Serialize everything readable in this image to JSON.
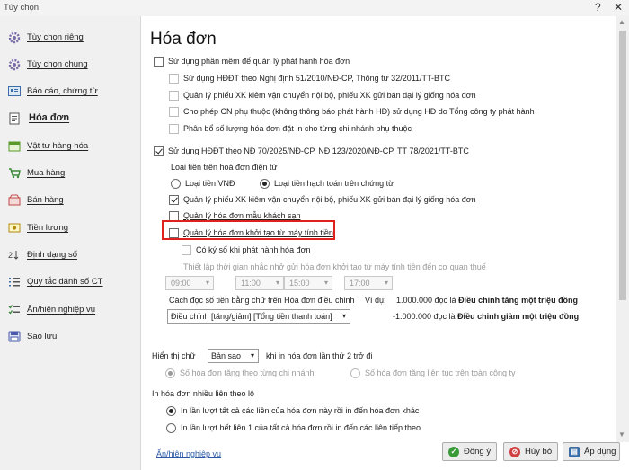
{
  "window": {
    "title": "Tùy chọn",
    "help": "?",
    "close": "✕"
  },
  "sidebar": {
    "items": [
      {
        "label": "Tùy chọn riêng",
        "icon": "gear-icon"
      },
      {
        "label": "Tùy chọn chung",
        "icon": "gear-icon"
      },
      {
        "label": "Báo cáo, chứng từ",
        "icon": "report-icon"
      },
      {
        "label": "Hóa đơn",
        "icon": "invoice-icon",
        "active": true
      },
      {
        "label": "Vật tư hàng hóa",
        "icon": "inventory-icon"
      },
      {
        "label": "Mua hàng",
        "icon": "cart-icon"
      },
      {
        "label": "Bán hàng",
        "icon": "sales-icon"
      },
      {
        "label": "Tiền lương",
        "icon": "salary-icon"
      },
      {
        "label": "Định dạng số",
        "icon": "number-format-icon"
      },
      {
        "label": "Quy tắc đánh số CT",
        "icon": "numbering-icon"
      },
      {
        "label": "Ẩn/hiện nghiệp vụ",
        "icon": "toggle-list-icon"
      },
      {
        "label": "Sao lưu",
        "icon": "backup-icon"
      }
    ]
  },
  "main": {
    "title": "Hóa đơn",
    "opt_software": "Sử dụng phần mềm để quản lý phát hành hóa đơn",
    "opt_nd51": "Sử dụng HĐĐT theo Nghị định 51/2010/NĐ-CP, Thông tư 32/2011/TT-BTC",
    "opt_nd51_xk": "Quản lý phiếu XK kiêm vận chuyển nội bộ, phiếu XK gửi bán đại lý giống hóa đơn",
    "opt_branch": "Cho phép CN phụ thuộc (không thông báo phát hành HĐ) sử dụng HĐ do Tổng công ty phát hành",
    "opt_alloc": "Phân bổ số lượng hóa đơn đặt in cho từng chi nhánh phụ thuộc",
    "opt_nd70": "Sử dụng HĐĐT theo NĐ 70/2025/NĐ-CP, NĐ 123/2020/NĐ-CP, TT 78/2021/TT-BTC",
    "currency_label": "Loại tiền trên hoá đơn điện tử",
    "currency_vnd": "Loại tiền VNĐ",
    "currency_acc": "Loại tiền hạch toán trên chứng từ",
    "opt_xk": "Quản lý phiếu XK kiêm vận chuyển nội bộ, phiếu XK gửi bán đại lý giống hóa đơn",
    "opt_hotel": "Quản lý hóa đơn mẫu khách sạn",
    "opt_cashreg": "Quản lý hóa đơn khởi tạo từ máy tính tiền",
    "opt_signed": "Có ký số khi phát hành hóa đơn",
    "reminder_label": "Thiết lập thời gian nhắc nhở gửi hóa đơn khởi tạo từ máy tính tiền đến cơ quan thuế",
    "times": [
      "09:00",
      "11:00",
      "15:00",
      "17:00"
    ],
    "read_label": "Cách đọc số tiền bằng chữ trên Hóa đơn điều chỉnh",
    "read_value": "Điều chỉnh [tăng/giảm] [Tổng tiền thanh toán]",
    "example_label": "Ví dụ:",
    "example1_prefix": "1.000.000 đọc là ",
    "example1_bold": "Điều chỉnh tăng một triệu đồng",
    "example2_prefix": "-1.000.000 đọc là ",
    "example2_bold": "Điều chỉnh giảm một triệu đồng",
    "show_label": "Hiển thị chữ",
    "show_value": "Bản sao",
    "show_suffix": "khi in hóa đơn lần thứ 2 trở đi",
    "show_opt1": "Số hóa đơn tăng theo từng chi nhánh",
    "show_opt2": "Số hóa đơn tăng liên tục trên toàn công ty",
    "print_label": "In hóa đơn nhiều liên theo lô",
    "print_opt1": "In lần lượt tất cả các liên của hóa đơn này rồi in đến hóa đơn khác",
    "print_opt2": "In lần lượt hết liên 1 của tất cả hóa đơn rồi in đến các liên tiếp theo"
  },
  "footer": {
    "link": "Ẩn/hiện nghiệp vụ",
    "ok": "Đồng ý",
    "cancel": "Hủy bỏ",
    "apply": "Áp dụng"
  },
  "colors": {
    "highlight": "#e0201c",
    "link": "#2a5aa6"
  }
}
